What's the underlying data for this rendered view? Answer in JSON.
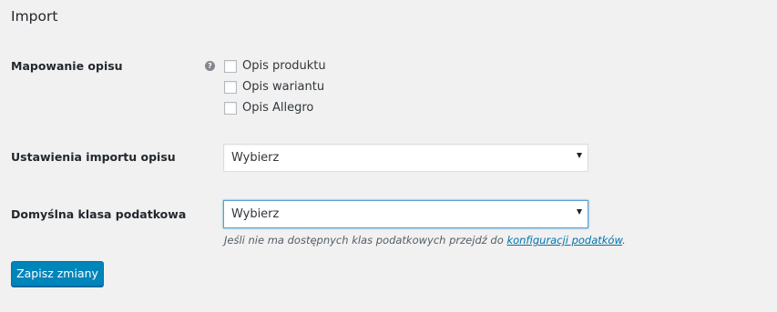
{
  "section": {
    "title": "Import"
  },
  "description_mapping": {
    "label": "Mapowanie opisu",
    "help_icon": "question-circle-icon",
    "help_glyph": "?",
    "options": [
      {
        "label": "Opis produktu",
        "checked": false
      },
      {
        "label": "Opis wariantu",
        "checked": false
      },
      {
        "label": "Opis Allegro",
        "checked": false
      }
    ]
  },
  "description_import_settings": {
    "label": "Ustawienia importu opisu",
    "selected": "Wybierz"
  },
  "default_tax_class": {
    "label": "Domyślna klasa podatkowa",
    "selected": "Wybierz",
    "description_prefix": "Jeśli nie ma dostępnych klas podatkowych przejdź do ",
    "description_link": "konfiguracji podatków",
    "description_suffix": "."
  },
  "actions": {
    "save_label": "Zapisz zmiany"
  },
  "colors": {
    "background": "#f1f1f1",
    "primary_button": "#0085ba",
    "link": "#0073aa",
    "focus_border": "#5b9dd9"
  }
}
